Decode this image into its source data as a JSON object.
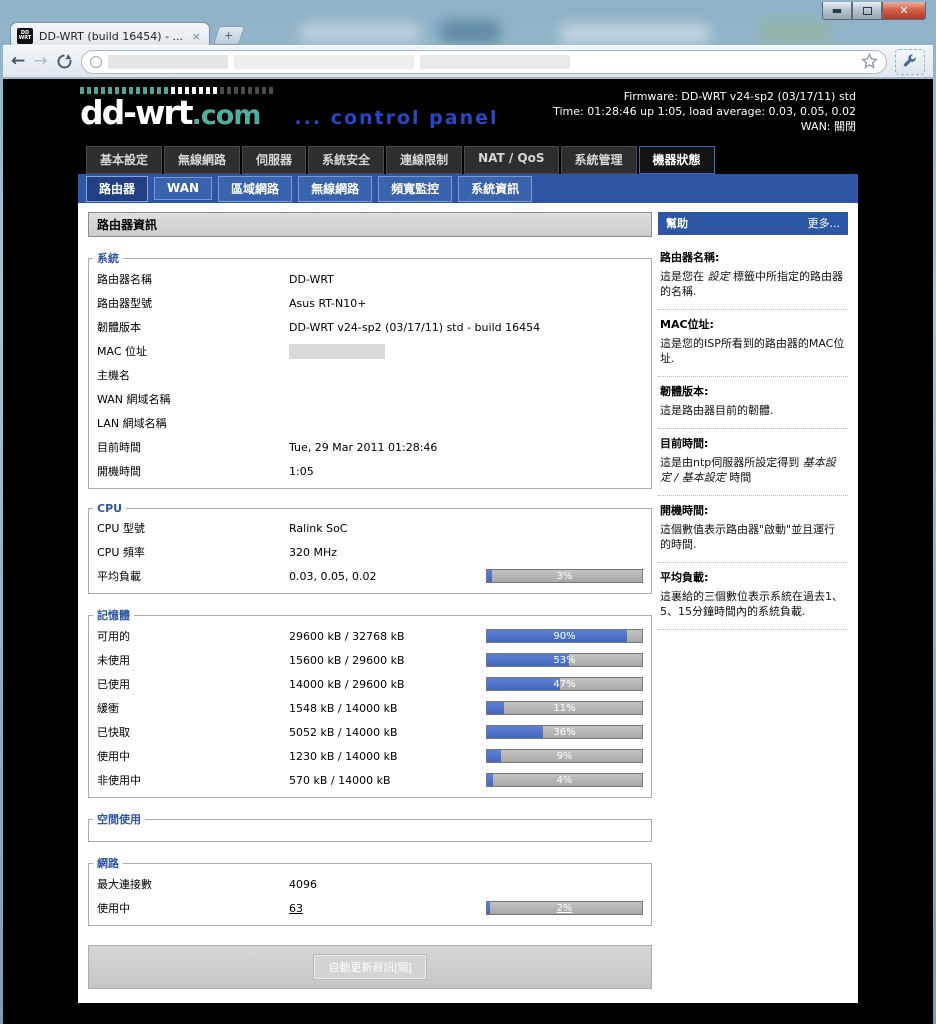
{
  "browser": {
    "tab_title": "DD-WRT (build 16454) - ...",
    "tab_close": "×",
    "new_tab": "+",
    "favicon_line1": "DD",
    "favicon_line2": "WRT",
    "back": "←",
    "forward": "→",
    "reload": "C",
    "minimize": "—",
    "close": "✕"
  },
  "header": {
    "logo_main": "dd-wrt",
    "logo_suffix": ".com",
    "logo_tagline": "... control panel",
    "logo_squares": [
      {
        "color": "#4fa397",
        "count": 13
      },
      {
        "color": "#ffffff",
        "count": 7
      },
      {
        "color": "#4a4a4a",
        "count": 8
      }
    ],
    "firmware_line": "Firmware: DD-WRT v24-sp2 (03/17/11) std",
    "time_line": "Time: 01:28:46 up 1:05, load average: 0.03, 0.05, 0.02",
    "wan_line": "WAN: 關閉"
  },
  "main_nav": {
    "tabs": [
      {
        "label": "基本設定",
        "active": false
      },
      {
        "label": "無線網路",
        "active": false
      },
      {
        "label": "伺服器",
        "active": false
      },
      {
        "label": "系統安全",
        "active": false
      },
      {
        "label": "連線限制",
        "active": false
      },
      {
        "label": "NAT / QoS",
        "active": false
      },
      {
        "label": "系統管理",
        "active": false
      },
      {
        "label": "機器狀態",
        "active": true
      }
    ]
  },
  "sub_nav": {
    "tabs": [
      {
        "label": "路由器",
        "active": true
      },
      {
        "label": "WAN",
        "active": false
      },
      {
        "label": "區域網路",
        "active": false
      },
      {
        "label": "無線網路",
        "active": false
      },
      {
        "label": "頻寬監控",
        "active": false
      },
      {
        "label": "系統資訊",
        "active": false
      }
    ]
  },
  "page": {
    "title": "路由器資訊"
  },
  "sections": [
    {
      "legend": "系統",
      "rows": [
        {
          "label": "路由器名稱",
          "value": "DD-WRT"
        },
        {
          "label": "路由器型號",
          "value": "Asus RT-N10+"
        },
        {
          "label": "韌體版本",
          "value": "DD-WRT v24-sp2 (03/17/11) std - build 16454"
        },
        {
          "label": "MAC 位址",
          "value": "",
          "redacted": true
        },
        {
          "label": "主機名",
          "value": ""
        },
        {
          "label": "WAN 網域名稱",
          "value": ""
        },
        {
          "label": "LAN 網域名稱",
          "value": ""
        },
        {
          "label": "目前時間",
          "value": "Tue, 29 Mar 2011 01:28:46"
        },
        {
          "label": "開機時間",
          "value": "1:05"
        }
      ]
    },
    {
      "legend": "CPU",
      "rows": [
        {
          "label": "CPU 型號",
          "value": "Ralink SoC"
        },
        {
          "label": "CPU 頻率",
          "value": "320 MHz"
        },
        {
          "label": "平均負載",
          "value": "0.03, 0.05, 0.02",
          "bar": 3
        }
      ]
    },
    {
      "legend": "記憶體",
      "rows": [
        {
          "label": "可用的",
          "value": "29600 kB / 32768 kB",
          "bar": 90
        },
        {
          "label": "未使用",
          "value": "15600 kB / 29600 kB",
          "bar": 53
        },
        {
          "label": "已使用",
          "value": "14000 kB / 29600 kB",
          "bar": 47
        },
        {
          "label": "緩衝",
          "value": "1548 kB / 14000 kB",
          "bar": 11
        },
        {
          "label": "已快取",
          "value": "5052 kB / 14000 kB",
          "bar": 36
        },
        {
          "label": "使用中",
          "value": "1230 kB / 14000 kB",
          "bar": 9
        },
        {
          "label": "非使用中",
          "value": "570 kB / 14000 kB",
          "bar": 4
        }
      ]
    },
    {
      "legend": "空間使用",
      "rows": []
    },
    {
      "legend": "網路",
      "rows": [
        {
          "label": "最大連接數",
          "value": "4096"
        },
        {
          "label": "使用中",
          "value": "63",
          "link": true,
          "bar": 2,
          "bar_link": true
        }
      ]
    }
  ],
  "footer": {
    "refresh_button": "自動更新資訊[開]"
  },
  "help": {
    "title": "幫助",
    "more_label": "更多...",
    "items": [
      {
        "heading": "路由器名稱:",
        "parts": [
          {
            "t": "這是您在 "
          },
          {
            "t": "設定",
            "em": true
          },
          {
            "t": " 標籤中所指定的路由器的名稱."
          }
        ]
      },
      {
        "heading": "MAC位址:",
        "parts": [
          {
            "t": "這是您的ISP所看到的路由器的MAC位址."
          }
        ]
      },
      {
        "heading": "韌體版本:",
        "parts": [
          {
            "t": "這是路由器目前的韌體."
          }
        ]
      },
      {
        "heading": "目前時間:",
        "parts": [
          {
            "t": "這是由ntp伺服器所設定得到 "
          },
          {
            "t": "基本設定 / 基本設定",
            "em": true
          },
          {
            "t": " 時間"
          }
        ]
      },
      {
        "heading": "開機時間:",
        "parts": [
          {
            "t": "這個數值表示路由器\"啟動\"並且運行的時間."
          }
        ]
      },
      {
        "heading": "平均負載:",
        "parts": [
          {
            "t": "這裏給的三個數位表示系統在過去1、5、15分鐘時間內的系統負載."
          }
        ]
      }
    ]
  },
  "colors": {
    "accent_blue": "#2d56a5",
    "active_subtab": "#203f85",
    "legend_blue": "#2e55a3",
    "bar_fill": "#4c70c5",
    "bar_track": "#b0b0b0",
    "logo_teal": "#4fae9e",
    "logo_tag_blue": "#2747c7",
    "page_bg": "#000000"
  }
}
